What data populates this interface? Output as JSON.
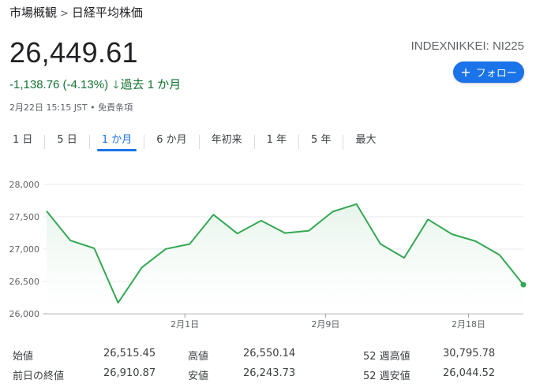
{
  "breadcrumb": {
    "parent": "市場概観",
    "separator": ">",
    "current": "日経平均株価"
  },
  "quote": {
    "price": "26,449.61",
    "ticker": "INDEXNIKKEI: NI225",
    "change": "-1,138.76 (-4.13%)",
    "change_arrow": "🡓",
    "change_period": "過去 1 か月",
    "timestamp": "2月22日 15:15 JST • 免責条項"
  },
  "follow_button": {
    "icon": "plus-icon",
    "label": "フォロー"
  },
  "tabs": [
    {
      "label": "1 日",
      "active": false
    },
    {
      "label": "5 日",
      "active": false
    },
    {
      "label": "1 か月",
      "active": true
    },
    {
      "label": "6 か月",
      "active": false
    },
    {
      "label": "年初来",
      "active": false
    },
    {
      "label": "1 年",
      "active": false
    },
    {
      "label": "5 年",
      "active": false
    },
    {
      "label": "最大",
      "active": false
    }
  ],
  "chart_data": {
    "type": "area",
    "title": "",
    "xlabel": "",
    "ylabel": "",
    "ylim": [
      26000,
      28000
    ],
    "yticks": [
      "28,000",
      "27,500",
      "27,000",
      "26,500",
      "26,000"
    ],
    "ytick_values": [
      28000,
      27500,
      27000,
      26500,
      26000
    ],
    "xticks": [
      "2月1日",
      "2月9日",
      "2月18日"
    ],
    "xtick_index": [
      5.8,
      11.7,
      17.7
    ],
    "grid": true,
    "color": "#34a853",
    "fill_color": "#e6f4ea",
    "values": [
      27588,
      27133,
      27012,
      26170,
      26717,
      27002,
      27078,
      27533,
      27241,
      27440,
      27249,
      27284,
      27579,
      27696,
      27080,
      26865,
      27460,
      27232,
      27122,
      26910,
      26449.61
    ]
  },
  "stats": [
    {
      "label": "始値",
      "value": "26,515.45"
    },
    {
      "label": "高値",
      "value": "26,550.14"
    },
    {
      "label": "52 週高値",
      "value": "30,795.78"
    },
    {
      "label": "前日の終値",
      "value": "26,910.87"
    },
    {
      "label": "安値",
      "value": "26,243.73"
    },
    {
      "label": "52 週安値",
      "value": "26,044.52"
    }
  ]
}
